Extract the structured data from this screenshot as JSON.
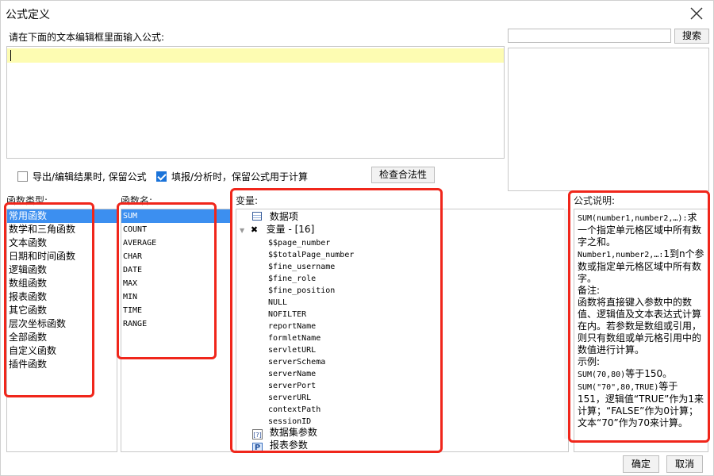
{
  "window": {
    "title": "公式定义"
  },
  "editor": {
    "prompt": "请在下面的文本编辑框里面输入公式:",
    "value": ""
  },
  "search": {
    "placeholder": "",
    "button_label": "搜索"
  },
  "options": {
    "export_keep_formula": {
      "label": "导出/编辑结果时, 保留公式",
      "checked": false
    },
    "fill_keep_formula": {
      "label": "填报/分析时，保留公式用于计算",
      "checked": true
    },
    "check_validity_label": "检查合法性"
  },
  "headers": {
    "function_type": "函数类型:",
    "function_name": "函数名:",
    "variables": "变量:",
    "description": "公式说明:"
  },
  "function_types": [
    "常用函数",
    "数学和三角函数",
    "文本函数",
    "日期和时间函数",
    "逻辑函数",
    "数组函数",
    "报表函数",
    "其它函数",
    "层次坐标函数",
    "全部函数",
    "自定义函数",
    "插件函数"
  ],
  "function_names": [
    "SUM",
    "COUNT",
    "AVERAGE",
    "CHAR",
    "DATE",
    "MAX",
    "MIN",
    "TIME",
    "RANGE"
  ],
  "variables": {
    "data_items": "数据项",
    "variable_group": "变量 - [16]",
    "items": [
      "$$page_number",
      "$$totalPage_number",
      "$fine_username",
      "$fine_role",
      "$fine_position",
      "NULL",
      "NOFILTER",
      "reportName",
      "formletName",
      "servletURL",
      "serverSchema",
      "serverName",
      "serverPort",
      "serverURL",
      "contextPath",
      "sessionID"
    ],
    "dataset_params": "数据集参数",
    "report_params": "报表参数"
  },
  "description": {
    "line1_code": "SUM(number1,number2,…):",
    "line1_text": "求一个指定单元格区域中所有数字之和。",
    "line2_code": "Number1,number2,…:",
    "line2_text": "1到n个参数或指定单元格区域中所有数字。",
    "note_label": "备注:",
    "note_text": "函数将直接键入参数中的数值、逻辑值及文本表达式计算在内。若参数是数组或引用，则只有数组或单元格引用中的数值进行计算。",
    "example_label": "示例:",
    "ex1_code": "SUM(70,80)",
    "ex1_text": "等于150。",
    "ex2_code": "SUM(\"70\",80,TRUE)",
    "ex2_text": "等于151，逻辑值“TRUE”作为1来计算；“FALSE”作为0计算；文本“70”作为70来计算。"
  },
  "buttons": {
    "ok": "确定",
    "cancel": "取消"
  },
  "colors": {
    "selection": "#3c8ff0",
    "annotation": "#f0261b",
    "editor_highlight": "#fdfcb2",
    "checkbox_checked": "#1a73d9"
  }
}
